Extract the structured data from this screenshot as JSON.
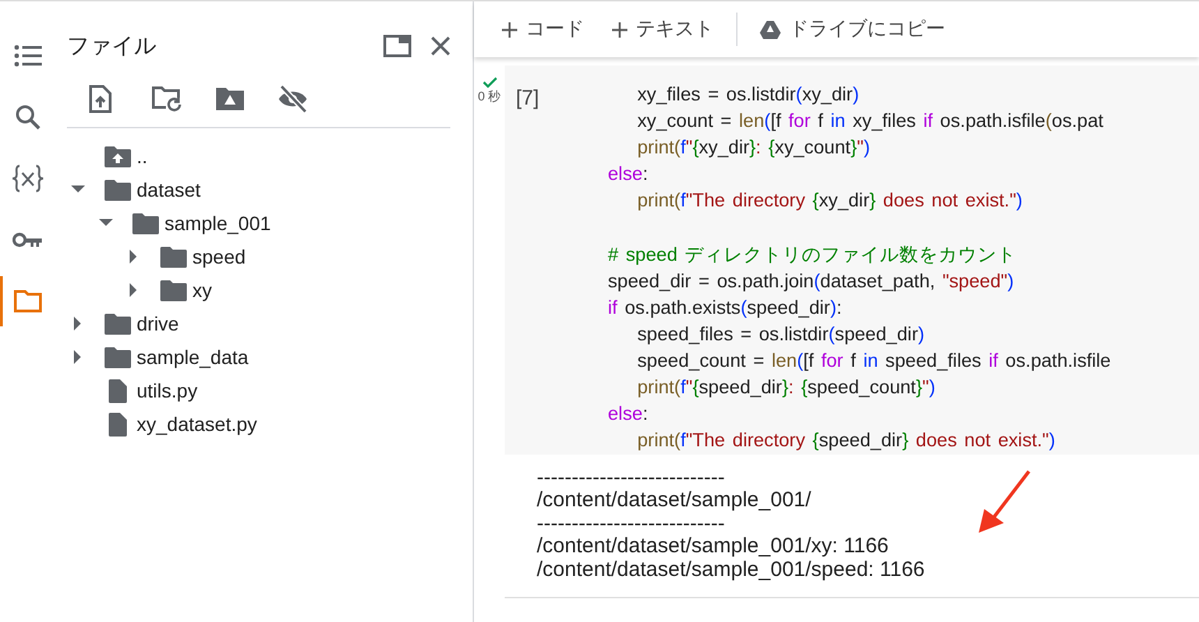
{
  "rail": [
    {
      "kind": "toc",
      "selected": false
    },
    {
      "kind": "search",
      "selected": false
    },
    {
      "kind": "variables",
      "selected": false
    },
    {
      "kind": "secrets",
      "selected": false
    },
    {
      "kind": "files",
      "selected": true
    }
  ],
  "file_panel": {
    "title": "ファイル",
    "tools": [
      {
        "kind": "upload"
      },
      {
        "kind": "refresh"
      },
      {
        "kind": "drive"
      },
      {
        "kind": "hide"
      }
    ],
    "tree": [
      {
        "name": "..",
        "kind": "parent"
      },
      {
        "name": "dataset",
        "kind": "folder",
        "expanded": true,
        "children": [
          {
            "name": "sample_001",
            "kind": "folder",
            "expanded": true,
            "children": [
              {
                "name": "speed",
                "kind": "folder",
                "expanded": false
              },
              {
                "name": "xy",
                "kind": "folder",
                "expanded": false
              }
            ]
          }
        ]
      },
      {
        "name": "drive",
        "kind": "folder",
        "expanded": false
      },
      {
        "name": "sample_data",
        "kind": "folder",
        "expanded": false
      },
      {
        "name": "utils.py",
        "kind": "file"
      },
      {
        "name": "xy_dataset.py",
        "kind": "file"
      }
    ]
  },
  "toolbar": [
    {
      "kind": "add",
      "label": "コード"
    },
    {
      "kind": "add",
      "label": "テキスト"
    },
    {
      "kind": "drive",
      "label": "ドライブにコピー"
    }
  ],
  "cell": {
    "done": true,
    "time": "0 秒",
    "exec_count": "[7]",
    "lines": [
      {
        "kind": "code",
        "tokens": [
          {
            "kind": "plain",
            "text": "    xy_files = os.listdir"
          },
          {
            "kind": "bracket",
            "text": "("
          },
          {
            "kind": "plain",
            "text": "xy_dir"
          },
          {
            "kind": "bracket",
            "text": ")"
          }
        ]
      },
      {
        "kind": "code",
        "tokens": [
          {
            "kind": "plain",
            "text": "    xy_count = "
          },
          {
            "kind": "builtin",
            "text": "len"
          },
          {
            "kind": "bracket",
            "text": "("
          },
          {
            "kind": "plain",
            "text": "[f "
          },
          {
            "kind": "keyword",
            "text": "for"
          },
          {
            "kind": "plain",
            "text": " f "
          },
          {
            "kind": "bracket",
            "text": "in"
          },
          {
            "kind": "plain",
            "text": " xy_files "
          },
          {
            "kind": "keyword",
            "text": "if"
          },
          {
            "kind": "plain",
            "text": " os.path.isfile"
          },
          {
            "kind": "builtin",
            "text": "("
          },
          {
            "kind": "plain",
            "text": "os.pat"
          }
        ]
      },
      {
        "kind": "code",
        "tokens": [
          {
            "kind": "builtin",
            "text": "    print("
          },
          {
            "kind": "bracket",
            "text": "f"
          },
          {
            "kind": "string",
            "text": "\""
          },
          {
            "kind": "brace",
            "text": "{"
          },
          {
            "kind": "plain",
            "text": "xy_dir"
          },
          {
            "kind": "brace",
            "text": "}"
          },
          {
            "kind": "string",
            "text": ": "
          },
          {
            "kind": "brace",
            "text": "{"
          },
          {
            "kind": "plain",
            "text": "xy_count"
          },
          {
            "kind": "brace",
            "text": "}"
          },
          {
            "kind": "string",
            "text": "\""
          },
          {
            "kind": "bracket",
            "text": ")"
          }
        ]
      },
      {
        "kind": "code",
        "tokens": [
          {
            "kind": "keyword",
            "text": "else"
          },
          {
            "kind": "plain",
            "text": ":"
          }
        ]
      },
      {
        "kind": "code",
        "tokens": [
          {
            "kind": "builtin",
            "text": "    print("
          },
          {
            "kind": "bracket",
            "text": "f"
          },
          {
            "kind": "string",
            "text": "\"The directory "
          },
          {
            "kind": "brace",
            "text": "{"
          },
          {
            "kind": "plain",
            "text": "xy_dir"
          },
          {
            "kind": "brace",
            "text": "}"
          },
          {
            "kind": "string",
            "text": " does not exist.\""
          },
          {
            "kind": "bracket",
            "text": ")"
          }
        ]
      },
      {
        "kind": "blank"
      },
      {
        "kind": "code",
        "tokens": [
          {
            "kind": "comment",
            "text": "# speed ディレクトリのファイル数をカウント"
          }
        ]
      },
      {
        "kind": "code",
        "tokens": [
          {
            "kind": "plain",
            "text": "speed_dir = os.path.join"
          },
          {
            "kind": "bracket",
            "text": "("
          },
          {
            "kind": "plain",
            "text": "dataset_path, "
          },
          {
            "kind": "string",
            "text": "\"speed\""
          },
          {
            "kind": "bracket",
            "text": ")"
          }
        ]
      },
      {
        "kind": "code",
        "tokens": [
          {
            "kind": "keyword",
            "text": "if"
          },
          {
            "kind": "plain",
            "text": " os.path.exists"
          },
          {
            "kind": "bracket",
            "text": "("
          },
          {
            "kind": "plain",
            "text": "speed_dir"
          },
          {
            "kind": "bracket",
            "text": ")"
          },
          {
            "kind": "plain",
            "text": ":"
          }
        ]
      },
      {
        "kind": "code",
        "tokens": [
          {
            "kind": "plain",
            "text": "    speed_files = os.listdir"
          },
          {
            "kind": "bracket",
            "text": "("
          },
          {
            "kind": "plain",
            "text": "speed_dir"
          },
          {
            "kind": "bracket",
            "text": ")"
          }
        ]
      },
      {
        "kind": "code",
        "tokens": [
          {
            "kind": "plain",
            "text": "    speed_count = "
          },
          {
            "kind": "builtin",
            "text": "len"
          },
          {
            "kind": "bracket",
            "text": "("
          },
          {
            "kind": "plain",
            "text": "[f "
          },
          {
            "kind": "keyword",
            "text": "for"
          },
          {
            "kind": "plain",
            "text": " f "
          },
          {
            "kind": "bracket",
            "text": "in"
          },
          {
            "kind": "plain",
            "text": " speed_files "
          },
          {
            "kind": "keyword",
            "text": "if"
          },
          {
            "kind": "plain",
            "text": " os.path.isfile"
          }
        ]
      },
      {
        "kind": "code",
        "tokens": [
          {
            "kind": "builtin",
            "text": "    print("
          },
          {
            "kind": "bracket",
            "text": "f"
          },
          {
            "kind": "string",
            "text": "\""
          },
          {
            "kind": "brace",
            "text": "{"
          },
          {
            "kind": "plain",
            "text": "speed_dir"
          },
          {
            "kind": "brace",
            "text": "}"
          },
          {
            "kind": "string",
            "text": ": "
          },
          {
            "kind": "brace",
            "text": "{"
          },
          {
            "kind": "plain",
            "text": "speed_count"
          },
          {
            "kind": "brace",
            "text": "}"
          },
          {
            "kind": "string",
            "text": "\""
          },
          {
            "kind": "bracket",
            "text": ")"
          }
        ]
      },
      {
        "kind": "code",
        "tokens": [
          {
            "kind": "keyword",
            "text": "else"
          },
          {
            "kind": "plain",
            "text": ":"
          }
        ]
      },
      {
        "kind": "code",
        "tokens": [
          {
            "kind": "builtin",
            "text": "    print("
          },
          {
            "kind": "bracket",
            "text": "f"
          },
          {
            "kind": "string",
            "text": "\"The directory "
          },
          {
            "kind": "brace",
            "text": "{"
          },
          {
            "kind": "plain",
            "text": "speed_dir"
          },
          {
            "kind": "brace",
            "text": "}"
          },
          {
            "kind": "string",
            "text": " does not exist.\""
          },
          {
            "kind": "bracket",
            "text": ")"
          }
        ]
      }
    ],
    "output": [
      "---------------------------",
      "/content/dataset/sample_001/",
      "---------------------------",
      "/content/dataset/sample_001/xy: 1166",
      "/content/dataset/sample_001/speed: 1166"
    ],
    "annotations": [
      {
        "kind": "arrow"
      }
    ]
  }
}
